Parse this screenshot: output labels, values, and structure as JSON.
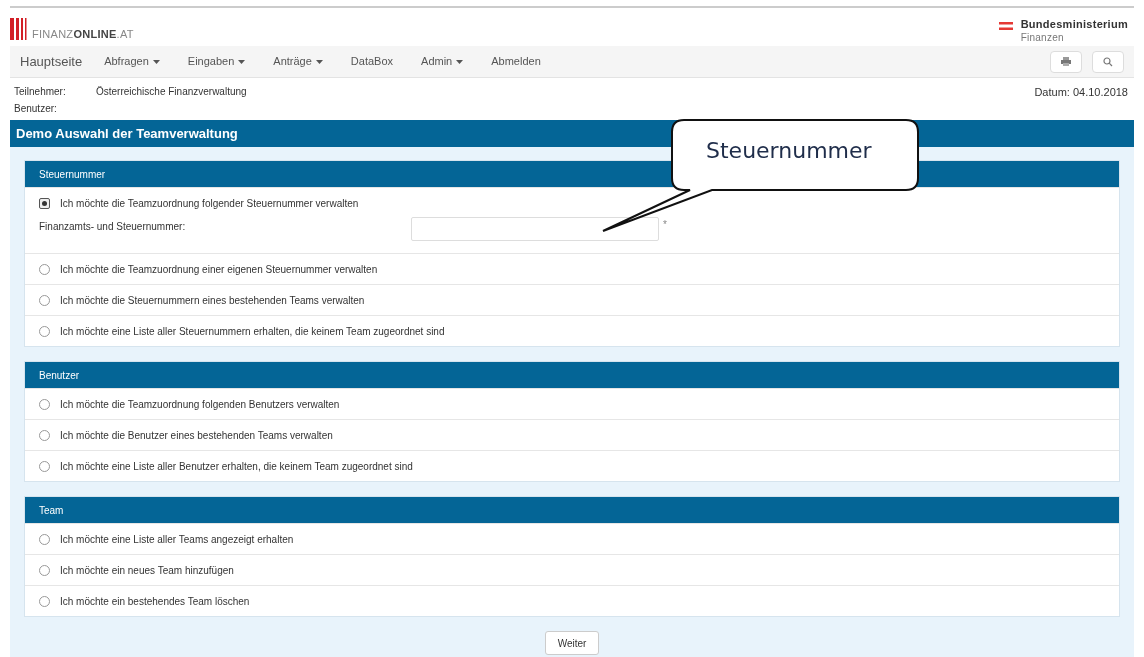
{
  "header": {
    "logo_text_light": "FINANZ",
    "logo_text_bold": "ONLINE",
    "logo_text_suffix": ".AT",
    "ministry_line1": "Bundesministerium",
    "ministry_line2": "Finanzen"
  },
  "nav": {
    "home": "Hauptseite",
    "items": [
      {
        "label": "Abfragen",
        "dropdown": true
      },
      {
        "label": "Eingaben",
        "dropdown": true
      },
      {
        "label": "Anträge",
        "dropdown": true
      },
      {
        "label": "DataBox",
        "dropdown": false
      },
      {
        "label": "Admin",
        "dropdown": true
      },
      {
        "label": "Abmelden",
        "dropdown": false
      }
    ]
  },
  "info": {
    "participant_label": "Teilnehmer:",
    "participant_value": "Österreichische Finanzverwaltung",
    "user_label": "Benutzer:",
    "date": "Datum: 04.10.2018"
  },
  "page_title": "Demo Auswahl der Teamverwaltung",
  "sections": [
    {
      "title": "Steuernummer",
      "options": [
        {
          "label": "Ich möchte die Teamzuordnung folgender Steuernummer verwalten",
          "selected": true,
          "field": {
            "label": "Finanzamts- und Steuernummer:",
            "required_mark": "*"
          }
        },
        {
          "label": "Ich möchte die Teamzuordnung einer eigenen Steuernummer verwalten",
          "selected": false
        },
        {
          "label": "Ich möchte die Steuernummern eines bestehenden Teams verwalten",
          "selected": false
        },
        {
          "label": "Ich möchte eine Liste aller Steuernummern erhalten, die keinem Team zugeordnet sind",
          "selected": false
        }
      ]
    },
    {
      "title": "Benutzer",
      "options": [
        {
          "label": "Ich möchte die Teamzuordnung folgenden Benutzers verwalten",
          "selected": false
        },
        {
          "label": "Ich möchte die Benutzer eines bestehenden Teams verwalten",
          "selected": false
        },
        {
          "label": "Ich möchte eine Liste aller Benutzer erhalten, die keinem Team zugeordnet sind",
          "selected": false
        }
      ]
    },
    {
      "title": "Team",
      "options": [
        {
          "label": "Ich möchte eine Liste aller Teams angezeigt erhalten",
          "selected": false
        },
        {
          "label": "Ich möchte ein neues Team hinzufügen",
          "selected": false
        },
        {
          "label": "Ich möchte ein bestehendes Team löschen",
          "selected": false
        }
      ]
    }
  ],
  "submit": "Weiter",
  "callout": {
    "text": "Steuernummer"
  }
}
